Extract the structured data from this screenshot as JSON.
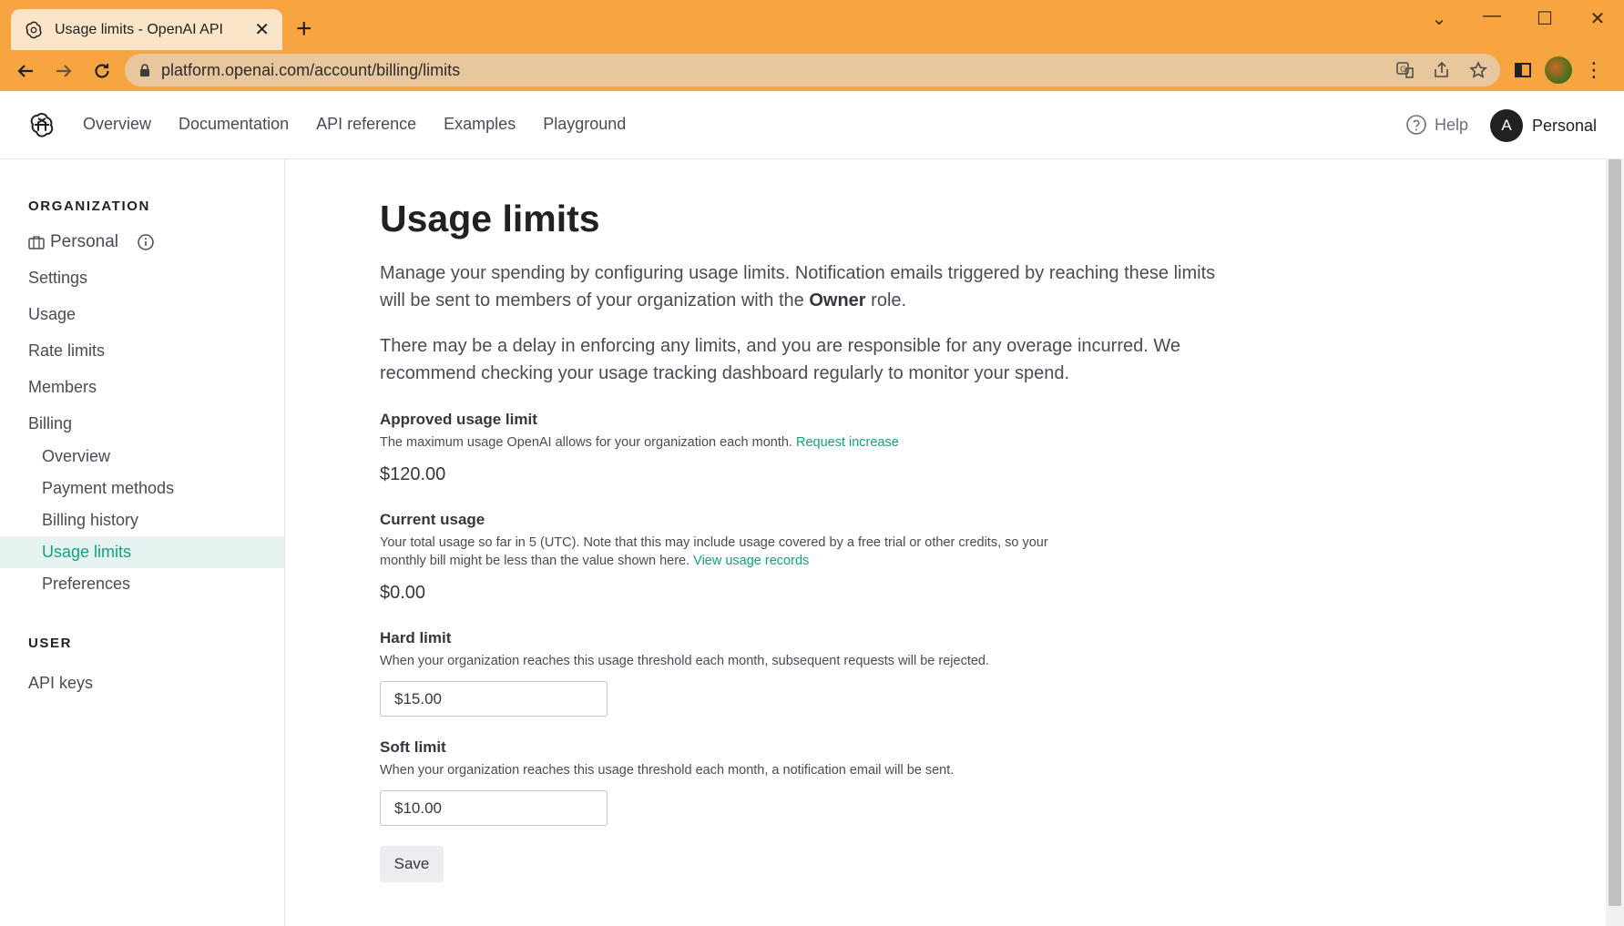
{
  "browser": {
    "tab_title": "Usage limits - OpenAI API",
    "url": "platform.openai.com/account/billing/limits"
  },
  "header": {
    "nav": [
      "Overview",
      "Documentation",
      "API reference",
      "Examples",
      "Playground"
    ],
    "help": "Help",
    "avatar_initial": "A",
    "account_name": "Personal"
  },
  "sidebar": {
    "org_title": "ORGANIZATION",
    "org_name": "Personal",
    "items": [
      "Settings",
      "Usage",
      "Rate limits",
      "Members",
      "Billing"
    ],
    "billing_sub": [
      "Overview",
      "Payment methods",
      "Billing history",
      "Usage limits",
      "Preferences"
    ],
    "active": "Usage limits",
    "user_title": "USER",
    "user_items": [
      "API keys"
    ]
  },
  "main": {
    "title": "Usage limits",
    "intro_1": "Manage your spending by configuring usage limits. Notification emails triggered by reaching these limits will be sent to members of your organization with the",
    "intro_1_bold": "Owner",
    "intro_1_end": "role.",
    "intro_2": "There may be a delay in enforcing any limits, and you are responsible for any overage incurred. We recommend checking your usage tracking dashboard regularly to monitor your spend.",
    "approved": {
      "label": "Approved usage limit",
      "desc": "The maximum usage OpenAI allows for your organization each month.",
      "link": "Request increase",
      "value": "$120.00"
    },
    "current": {
      "label": "Current usage",
      "desc": "Your total usage so far in 5 (UTC). Note that this may include usage covered by a free trial or other credits, so your monthly bill might be less than the value shown here.",
      "link": "View usage records",
      "value": "$0.00"
    },
    "hard": {
      "label": "Hard limit",
      "desc": "When your organization reaches this usage threshold each month, subsequent requests will be rejected.",
      "value": "$15.00"
    },
    "soft": {
      "label": "Soft limit",
      "desc": "When your organization reaches this usage threshold each month, a notification email will be sent.",
      "value": "$10.00"
    },
    "save": "Save"
  },
  "colors": {
    "chrome": "#f7a541",
    "accent": "#10a37f"
  }
}
